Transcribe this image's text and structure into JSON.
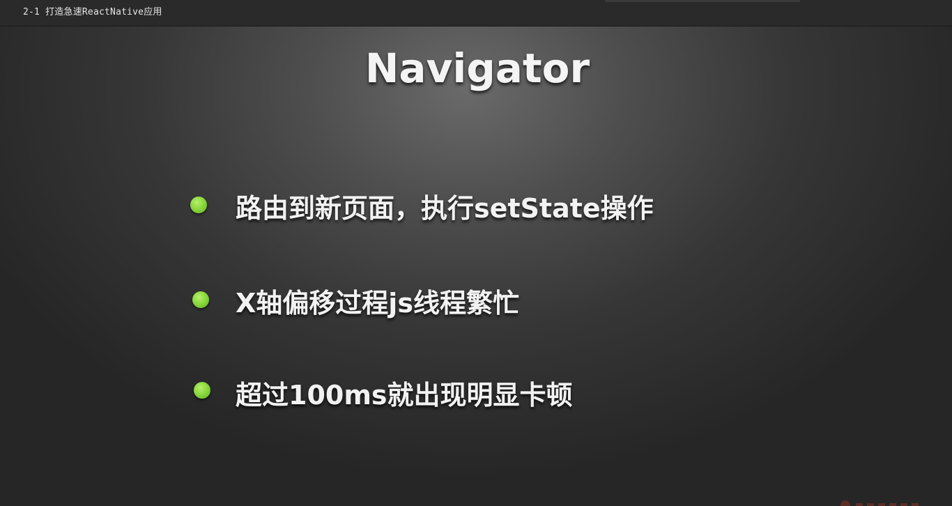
{
  "window": {
    "title": "2-1 打造急速ReactNative应用"
  },
  "slide": {
    "title": "Navigator",
    "bullets": [
      {
        "text": "路由到新页面，执行setState操作",
        "icon": "green-dot-icon"
      },
      {
        "text": "X轴偏移过程js线程繁忙",
        "icon": "green-dot-icon"
      },
      {
        "text": "超过100ms就出现明显卡顿",
        "icon": "green-dot-icon"
      }
    ],
    "colors": {
      "background": "#3a3a3a",
      "bullet_dot": "#8cd840",
      "text": "#f2f2f2"
    }
  },
  "watermark": {
    "icon": "logo-watermark-icon"
  }
}
